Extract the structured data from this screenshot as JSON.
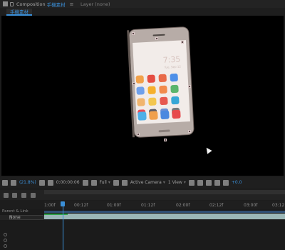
{
  "header": {
    "panel_label": "Composition",
    "comp_name": "手機素材",
    "menu": "≡",
    "layer_panel": "Layer (none)"
  },
  "tabs": {
    "active": "手機素材"
  },
  "screen": {
    "time": "7:35",
    "date": "Tue, Sep 12"
  },
  "toolbar": {
    "zoom": "(21.8%)",
    "timecode": "0:00:00:06",
    "resolution": "Full",
    "camera": "Active Camera",
    "views": "1 View",
    "exposure": "+0.0"
  },
  "timeline": {
    "ticks": [
      "1:00f",
      "00:12f",
      "01:00f",
      "01:12f",
      "02:00f",
      "02:12f",
      "03:00f",
      "03:12"
    ],
    "column_label": "Parent & Link",
    "parent_value": "None"
  },
  "colors": {
    "accent": "#3a8fd8",
    "viewer_bg": "#000000",
    "timeline_bar": "#9cb8b8",
    "work_area": "#2f4f73"
  },
  "icons": {
    "apps": [
      "#f1a14a",
      "#e54d42",
      "#e86a49",
      "#4d8fe8",
      "#6fa0ea",
      "#f6b02c",
      "#f28a4b",
      "#5bb56c",
      "#f1b56e",
      "#f3c64f",
      "#e7574e",
      "#36a7d6",
      "#e94b55",
      "#5c5c66",
      "#6a8ed5",
      "#7a7a7a"
    ],
    "dock": [
      "#4fb0e8",
      "#f0a04c",
      "#4c88df",
      "#e74a4d"
    ]
  }
}
